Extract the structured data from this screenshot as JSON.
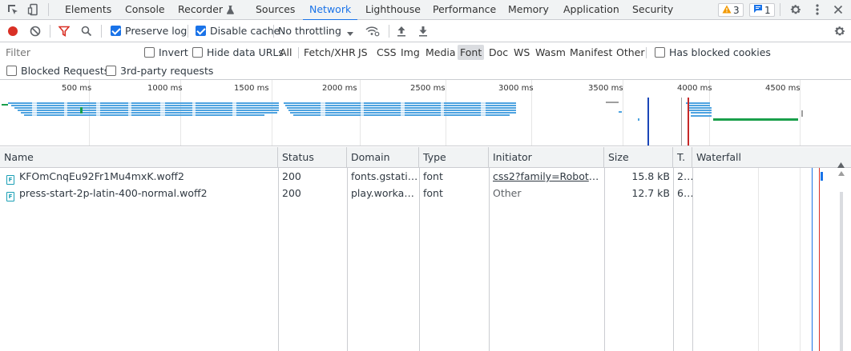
{
  "tabs": [
    {
      "label": "Elements"
    },
    {
      "label": "Console"
    },
    {
      "label": "Recorder"
    },
    {
      "label": "Sources"
    },
    {
      "label": "Network"
    },
    {
      "label": "Lighthouse"
    },
    {
      "label": "Performance"
    },
    {
      "label": "Memory"
    },
    {
      "label": "Application"
    },
    {
      "label": "Security"
    }
  ],
  "active_tab": "Network",
  "badges": {
    "warnings": "3",
    "messages": "1"
  },
  "toolbar": {
    "preserve_log": "Preserve log",
    "disable_cache": "Disable cache",
    "throttling": "No throttling",
    "preserve_log_checked": true,
    "disable_cache_checked": true
  },
  "filter": {
    "placeholder": "Filter",
    "invert": "Invert",
    "hide_data_urls": "Hide data URLs",
    "types": [
      "All",
      "Fetch/XHR",
      "JS",
      "CSS",
      "Img",
      "Media",
      "Font",
      "Doc",
      "WS",
      "Wasm",
      "Manifest",
      "Other"
    ],
    "selected_type": "Font",
    "has_blocked_cookies": "Has blocked cookies",
    "blocked_requests": "Blocked Requests",
    "third_party": "3rd-party requests"
  },
  "overview": {
    "ticks": [
      "500 ms",
      "1000 ms",
      "1500 ms",
      "2000 ms",
      "2500 ms",
      "3000 ms",
      "3500 ms",
      "4000 ms",
      "4500 ms"
    ]
  },
  "columns": [
    "Name",
    "Status",
    "Domain",
    "Type",
    "Initiator",
    "Size",
    "T.",
    "Waterfall"
  ],
  "rows": [
    {
      "name": "KFOmCnqEu92Fr1Mu4mxK.woff2",
      "status": "200",
      "domain": "fonts.gstatic...",
      "type": "font",
      "initiator": "css2?family=Roboto+C...",
      "size": "15.8 kB",
      "time": "2..."
    },
    {
      "name": "press-start-2p-latin-400-normal.woff2",
      "status": "200",
      "domain": "play.workad...",
      "type": "font",
      "initiator": "Other",
      "size": "12.7 kB",
      "time": "6..."
    }
  ],
  "colors": {
    "accent": "#1a73e8",
    "record": "#d93025",
    "filter_icon": "#d93025",
    "warning": "#f29900",
    "font_icon": "#1a9fb5"
  }
}
